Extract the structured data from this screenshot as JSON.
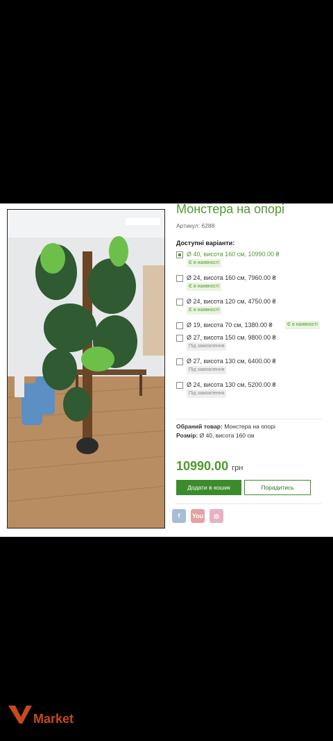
{
  "product": {
    "title": "Монстера на опорі",
    "sku": "Артикул: 6288",
    "available_heading": "Доступні варіанти:",
    "options": [
      {
        "text": "Ø 40, висота 160 см,  10990.00 ₴",
        "badge": "Є в наявності",
        "selected": true
      },
      {
        "text": "Ø 24, висота 160 см,  7960.00 ₴",
        "badge": "Є в наявності",
        "selected": false
      },
      {
        "text": "Ø 24, висота 120 см,  4750.00 ₴",
        "badge": "Є в наявності",
        "selected": false
      },
      {
        "text": "Ø 19, висота 70 см,  1380.00 ₴",
        "badge": "Є в наявності",
        "selected": false
      },
      {
        "text": "Ø 27, висота 150 см,  9800.00 ₴",
        "badge": "Під замовлення",
        "selected": false
      },
      {
        "text": "Ø 27, висота 130 см,  6400.00 ₴",
        "badge": "Під замовлення",
        "selected": false
      },
      {
        "text": "Ø 24, висота 130 см,  5200.00 ₴",
        "badge": "Під замовлення",
        "selected": false
      }
    ],
    "selected_label": "Обраний товар:",
    "selected_value": "Монстера на опорі",
    "size_label": "Розмір:",
    "size_value": "Ø 40, висота 160 см",
    "price": "10990.00",
    "currency": "грн",
    "add_to_cart": "Додати в кошик",
    "advise": "Порадитись"
  },
  "social": {
    "fb": "f",
    "yt": "You",
    "ig": "◎"
  },
  "watermark": {
    "brand": "Market"
  },
  "colors": {
    "accent": "#4e9a2f",
    "button": "#3c8c2e",
    "watermark": "#c84a1a"
  }
}
